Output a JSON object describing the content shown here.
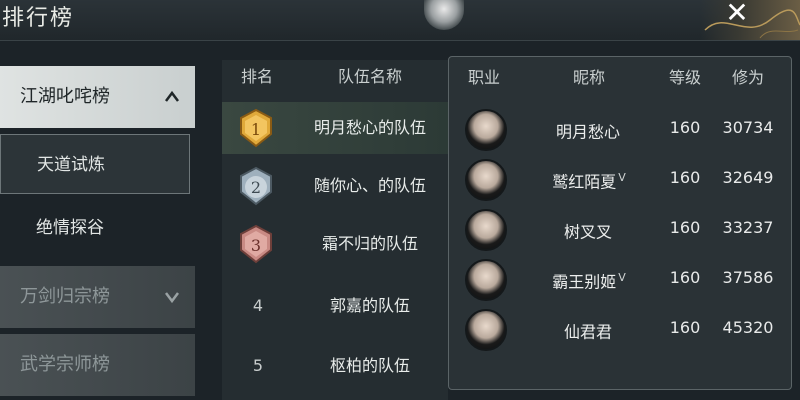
{
  "header": {
    "title": "排行榜"
  },
  "sidebar": {
    "categories": [
      {
        "label": "江湖叱咤榜",
        "expanded": true,
        "subs": [
          {
            "label": "天道试炼",
            "selected": true
          },
          {
            "label": "绝情探谷",
            "selected": false
          }
        ]
      },
      {
        "label": "万剑归宗榜",
        "expanded": false
      },
      {
        "label": "武学宗师榜",
        "expanded": false
      }
    ]
  },
  "teams": {
    "headers": {
      "rank": "排名",
      "name": "队伍名称"
    },
    "rows": [
      {
        "rank": "1",
        "name": "明月愁心的队伍",
        "medal": "gold"
      },
      {
        "rank": "2",
        "name": "随你心、的队伍",
        "medal": "silver"
      },
      {
        "rank": "3",
        "name": "霜不归的队伍",
        "medal": "bronze"
      },
      {
        "rank": "4",
        "name": "郭嘉的队伍"
      },
      {
        "rank": "5",
        "name": "枢柏的队伍"
      }
    ]
  },
  "members": {
    "headers": {
      "job": "职业",
      "nick": "昵称",
      "level": "等级",
      "power": "修为"
    },
    "rows": [
      {
        "nick": "明月愁心",
        "level": "160",
        "power": "30734",
        "vmark": ""
      },
      {
        "nick": "鹫红陌夏",
        "level": "160",
        "power": "32649",
        "vmark": "V"
      },
      {
        "nick": "树叉叉",
        "level": "160",
        "power": "33237",
        "vmark": ""
      },
      {
        "nick": "霸王别姬",
        "level": "160",
        "power": "37586",
        "vmark": "V"
      },
      {
        "nick": "仙君君",
        "level": "160",
        "power": "45320",
        "vmark": ""
      }
    ]
  },
  "colors": {
    "gold": "#e0a93a",
    "silver": "#9fb0bd",
    "bronze": "#c98a84"
  }
}
